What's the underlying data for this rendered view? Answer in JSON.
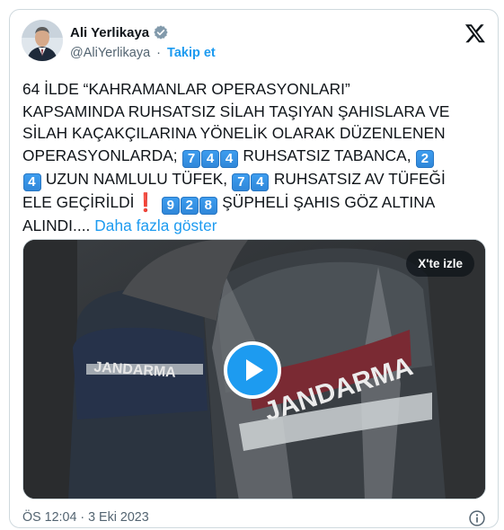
{
  "author": {
    "name": "Ali Yerlikaya",
    "handle": "@AliYerlikaya",
    "separator": "·",
    "follow_label": "Takip et"
  },
  "tweet": {
    "line1": "64 İLDE “KAHRAMANLAR OPERASYONLARI”",
    "line2": "KAPSAMINDA RUHSATSIZ SİLAH TAŞIYAN ŞAHISLARA VE",
    "line3": "SİLAH KAÇAKÇILARINA YÖNELİK OLARAK DÜZENLENEN",
    "line4a": "OPERASYONLARDA; ",
    "k1": "7",
    "k2": "4",
    "k3": "4",
    "line4b": " RUHSATSIZ TABANCA, ",
    "k4": "2",
    "k5": "4",
    "line5a": " UZUN NAMLULU TÜFEK, ",
    "k6": "7",
    "k7": "4",
    "line5b": " RUHSATSIZ AV TÜFEĞİ",
    "line6a": "ELE GEÇİRİLDİ",
    "exclamation": "❗",
    "k8": "9",
    "k9": "2",
    "k10": "8",
    "line6b": " ŞÜPHELİ ŞAHIS GÖZ ALTINA",
    "line7a": "ALINDI....",
    "show_more": "Daha fazla göster"
  },
  "media": {
    "watch_label": "X'te izle",
    "vest_text_1": "JANDARMA",
    "vest_text_2": "JANDARMA"
  },
  "footer": {
    "timestamp": "ÖS 12:04 · 3 Eki 2023"
  },
  "icons": {
    "verified": "verified-badge-icon",
    "brand": "x-logo-icon",
    "play": "play-icon",
    "info": "info-icon"
  },
  "colors": {
    "accent": "#1d9bf0",
    "text": "#0f1419",
    "muted": "#536471"
  }
}
